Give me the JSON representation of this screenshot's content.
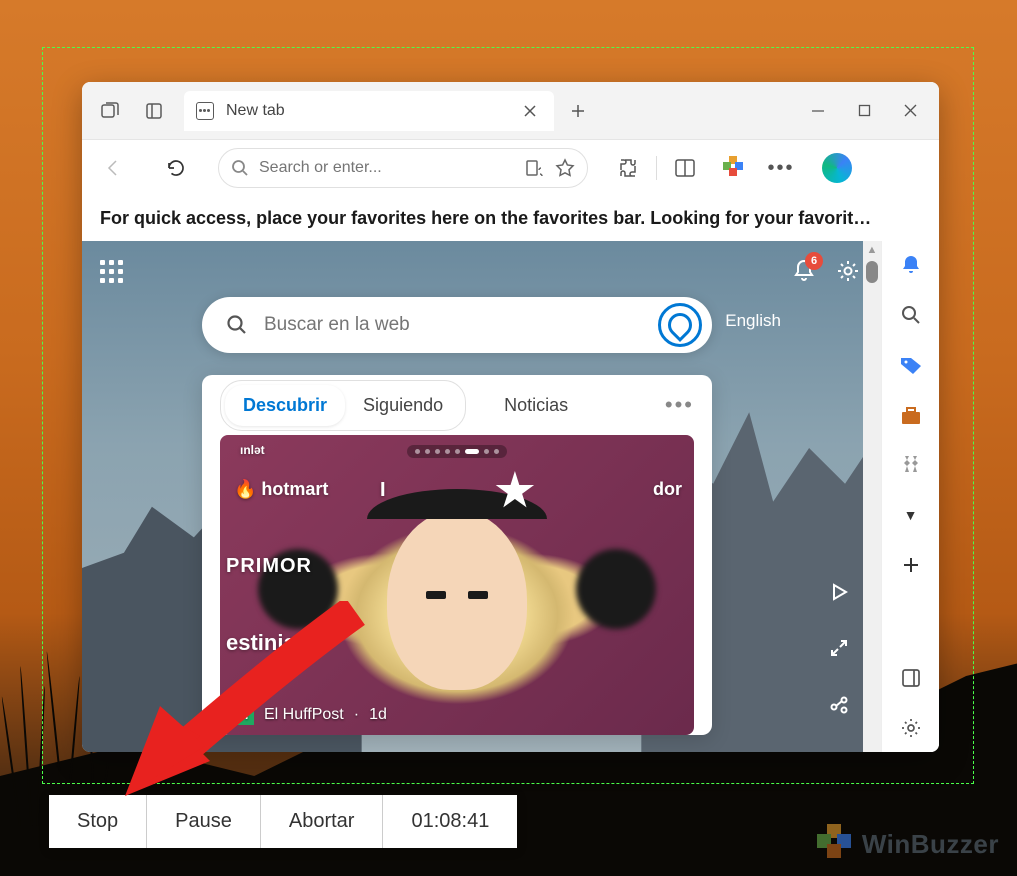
{
  "tab": {
    "title": "New tab"
  },
  "addressbar": {
    "placeholder": "Search or enter..."
  },
  "favorites_hint": "For quick access, place your favorites here on the favorites bar. Looking for your favorit…",
  "feed": {
    "notifications": "6",
    "search_placeholder": "Buscar en la web",
    "language": "English",
    "tabs": {
      "discover": "Descubrir",
      "following": "Siguiendo",
      "news": "Noticias"
    },
    "article": {
      "brands": {
        "hotmart": "hotmart",
        "primor": "PRIMOR",
        "destinia": "estinia",
        "I": "I",
        "dor": "dor",
        "int": "ınlǝt"
      },
      "source": "El HuffPost",
      "age": "1d"
    }
  },
  "recorder": {
    "stop": "Stop",
    "pause": "Pause",
    "abort": "Abortar",
    "time": "01:08:41"
  },
  "watermark": "WinBuzzer"
}
